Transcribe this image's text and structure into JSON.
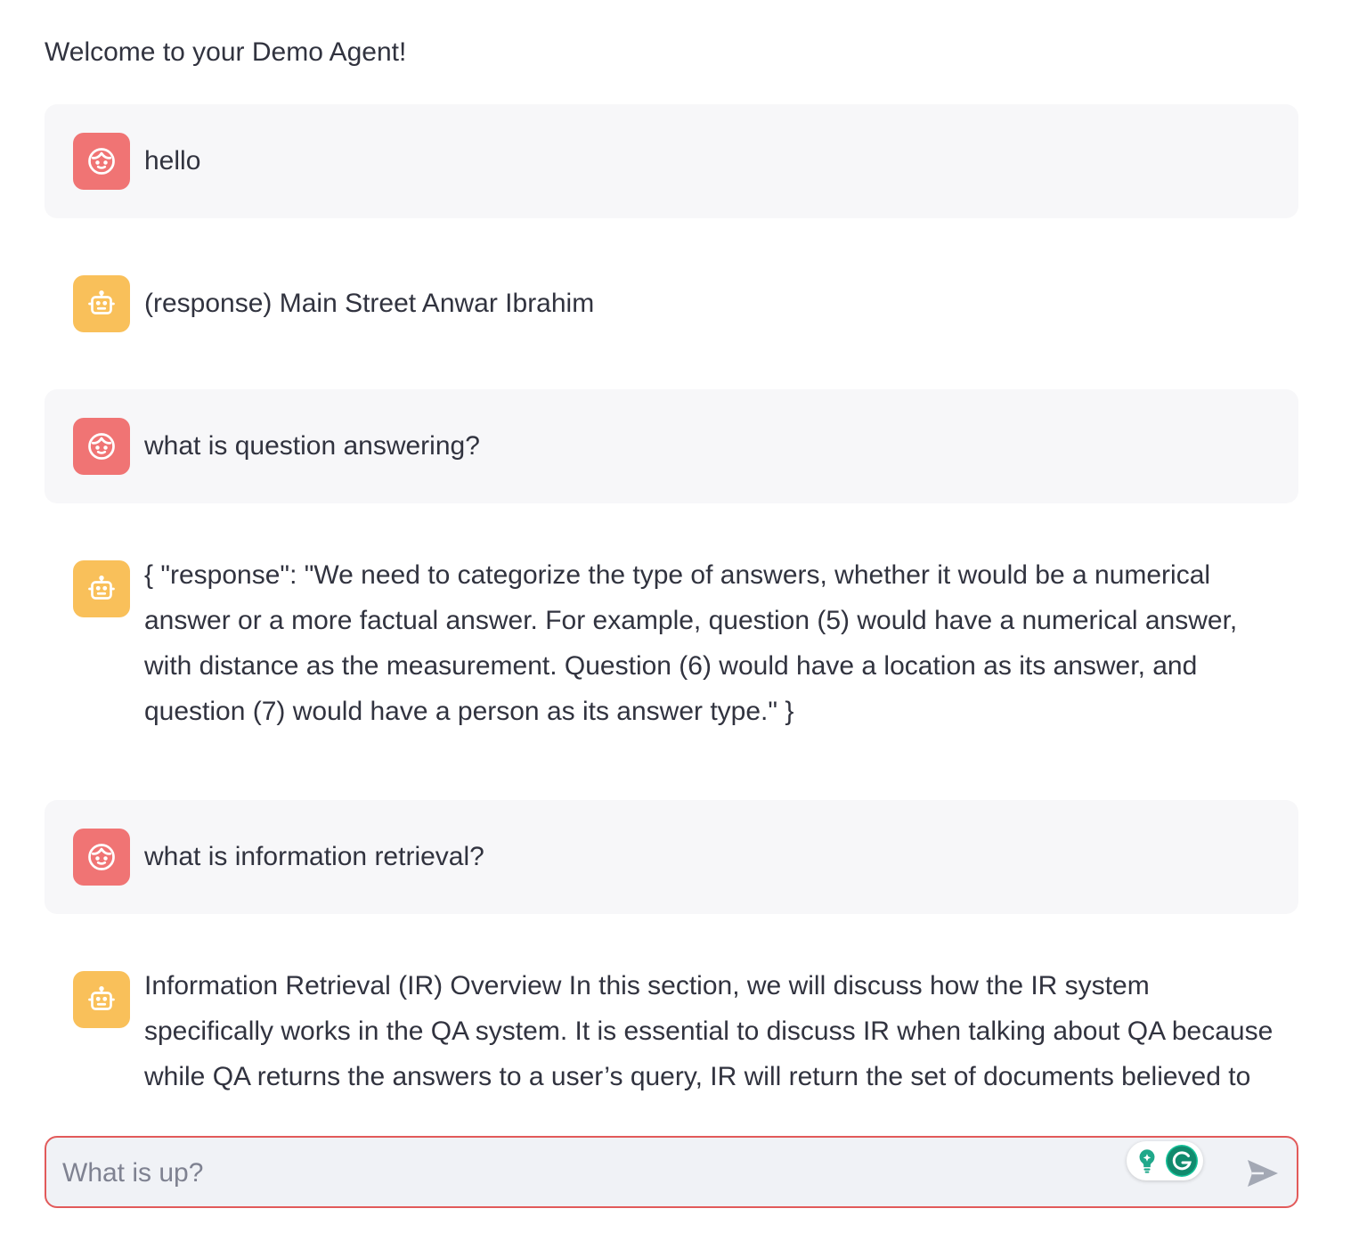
{
  "header": {
    "welcome": "Welcome to your Demo Agent!"
  },
  "messages": [
    {
      "role": "user",
      "avatar_icon": "user-face-icon",
      "text": "hello"
    },
    {
      "role": "assistant",
      "avatar_icon": "robot-icon",
      "text": "(response) Main Street Anwar Ibrahim"
    },
    {
      "role": "user",
      "avatar_icon": "user-face-icon",
      "text": "what is question answering?"
    },
    {
      "role": "assistant",
      "avatar_icon": "robot-icon",
      "text": "{ \"response\": \"We need to categorize the type of answers, whether it would be a numerical answer or a more factual answer. For example, question (5) would have a numerical answer, with distance as the measurement. Question (6) would have a location as its answer, and question (7) would have a person as its answer type.\" }"
    },
    {
      "role": "user",
      "avatar_icon": "user-face-icon",
      "text": "what is information retrieval?"
    },
    {
      "role": "assistant",
      "avatar_icon": "robot-icon",
      "text": "Information Retrieval (IR) Overview In this section, we will discuss how the IR system specifically works in the QA system. It is essential to discuss IR when talking about QA because while QA returns the answers to a user’s query, IR will return the set of documents believed to contain the"
    }
  ],
  "chat_input": {
    "placeholder": "What is up?",
    "value": "",
    "send_icon": "send-arrow-icon",
    "extension_icons": [
      "grammarly-suggestion-icon",
      "grammarly-logo-icon"
    ]
  },
  "colors": {
    "user_avatar": "#f07474",
    "assistant_avatar": "#f9c05a",
    "user_bubble": "#f7f7f9",
    "input_border": "#e25a5a",
    "input_background": "#f0f2f6"
  }
}
